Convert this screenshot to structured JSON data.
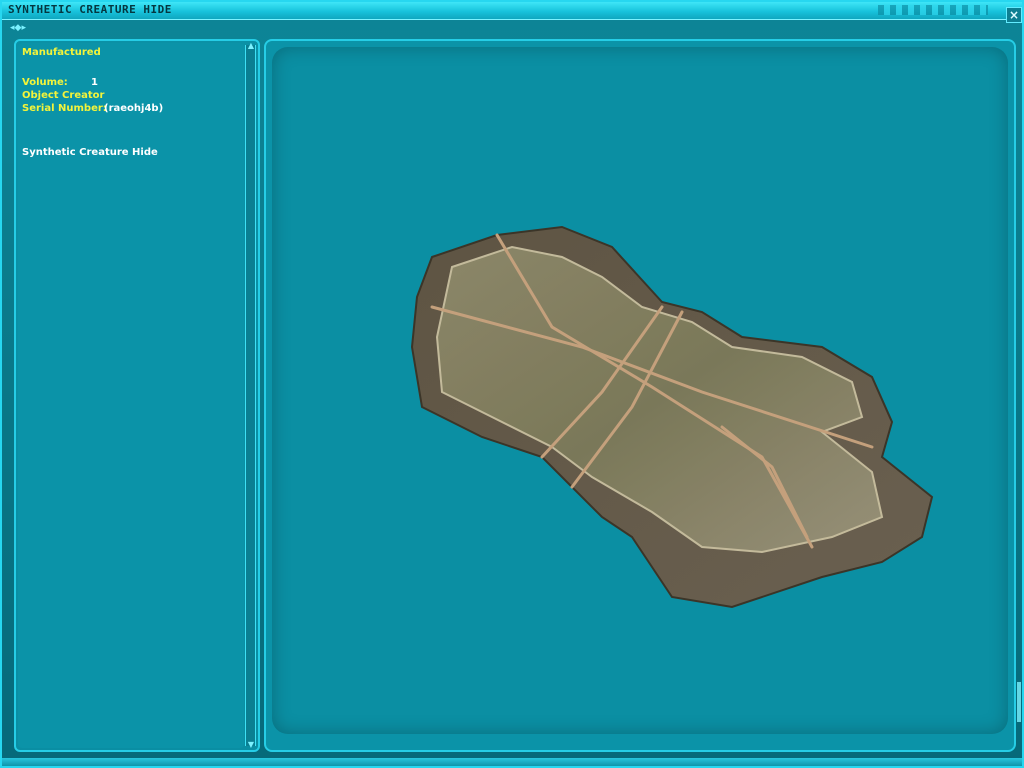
{
  "window": {
    "title": "SYNTHETIC CREATURE HIDE"
  },
  "info": {
    "type_label": "Manufactured",
    "volume_label": "Volume:",
    "volume_value": "1",
    "creator_label": "Object Creator",
    "serial_label": "Serial Number:",
    "serial_value": "(raeohj4b)",
    "description": "Synthetic Creature Hide"
  },
  "icons": {
    "close": "close-icon",
    "nav": "nav-arrows-icon",
    "scroll_up": "scroll-up-icon",
    "scroll_down": "scroll-down-icon"
  },
  "colors": {
    "accent": "#27d7f0",
    "label_yellow": "#f3f43a",
    "panel_bg": "#0b93a8"
  }
}
